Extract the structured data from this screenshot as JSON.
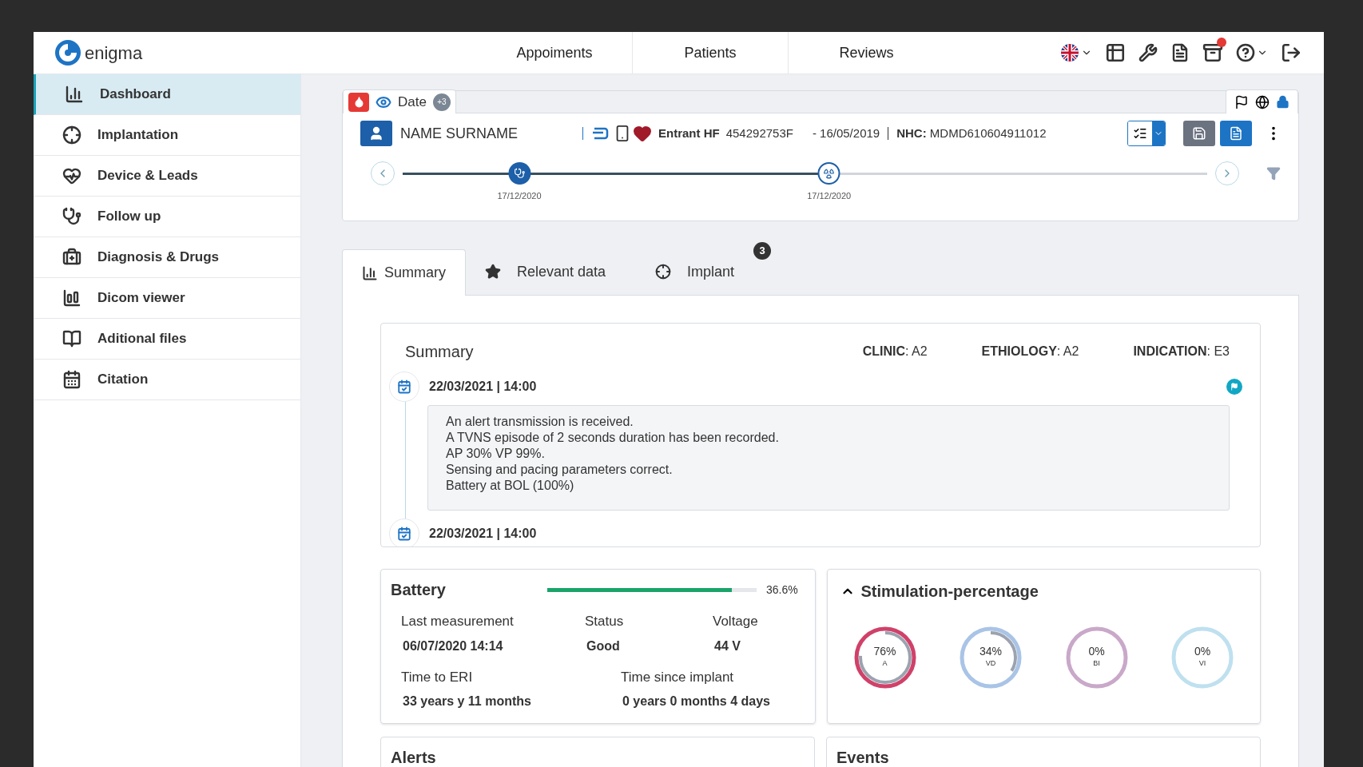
{
  "topbar": {
    "logo": "enigma",
    "nav": [
      {
        "label": "Appoiments"
      },
      {
        "label": "Patients"
      },
      {
        "label": "Reviews"
      }
    ],
    "notification": true
  },
  "sidebar": {
    "items": [
      {
        "label": "Dashboard",
        "selected": true
      },
      {
        "label": "Implantation",
        "selected": false
      },
      {
        "label": "Device & Leads",
        "selected": false
      },
      {
        "label": "Follow up",
        "selected": false
      },
      {
        "label": "Diagnosis & Drugs",
        "selected": false
      },
      {
        "label": "Dicom viewer",
        "selected": false
      },
      {
        "label": "Aditional files",
        "selected": false
      },
      {
        "label": "Citation",
        "selected": false
      }
    ]
  },
  "patient": {
    "date_tab": {
      "label": "Date",
      "badge": "+3"
    },
    "name": "NAME SURNAME",
    "device": "Entrant HF",
    "serial": "454292753F",
    "implant_date": "- 16/05/2019",
    "nhc": "**NHC:** MDMD610604911012",
    "timeline": {
      "level": 0.53,
      "points": [
        {
          "date": "17/12/2020"
        },
        {
          "date": "17/12/2020"
        }
      ]
    }
  },
  "tabs": [
    {
      "label": "Summary",
      "selected": true
    },
    {
      "label": "Relevant data",
      "selected": false
    },
    {
      "label": "Implant",
      "selected": false,
      "badge": "3"
    }
  ],
  "summary": {
    "title": "Summary",
    "codes": [
      "**CLINIC**: A2",
      "**ETHIOLOGY**: A2",
      "**INDICATION**: E3"
    ],
    "entries": [
      {
        "date": "22/03/2021 | 14:00",
        "lines": [
          "An alert transmission is received.",
          "A TVNS episode of 2 seconds duration has been recorded.",
          "AP 30% VP 99%.",
          "Sensing and pacing parameters correct.",
          "Battery at BOL (100%)"
        ]
      },
      {
        "date": "22/03/2021 | 14:00"
      }
    ]
  },
  "battery": {
    "title": "Battery",
    "level": 0.88,
    "reading": "36.6%",
    "fields": [
      {
        "label": "Last measurement",
        "value": "06/07/2020 14:14"
      },
      {
        "label": "Status",
        "value": "Good"
      },
      {
        "label": "Voltage",
        "value": "44 V"
      },
      {
        "label": "Time to ERI",
        "value": "33 years y 11 months"
      },
      {
        "label": "Time since implant",
        "value": "0 years 0 months 4 days"
      }
    ]
  },
  "stimulation": {
    "title": "Stimulation-percentage",
    "expanded": true,
    "rings": [
      {
        "value": "76%",
        "label": "A",
        "level": 0.76,
        "color": "#d0416a"
      },
      {
        "value": "34%",
        "label": "VD",
        "level": 0.34,
        "color": "#a9c4e6"
      },
      {
        "value": "0%",
        "label": "BI",
        "color": "#c9a8c9"
      },
      {
        "value": "0%",
        "label": "VI",
        "color": "#bfe0ef"
      }
    ]
  },
  "bottom_cards": [
    {
      "title": "Alerts"
    },
    {
      "title": "Events"
    }
  ]
}
